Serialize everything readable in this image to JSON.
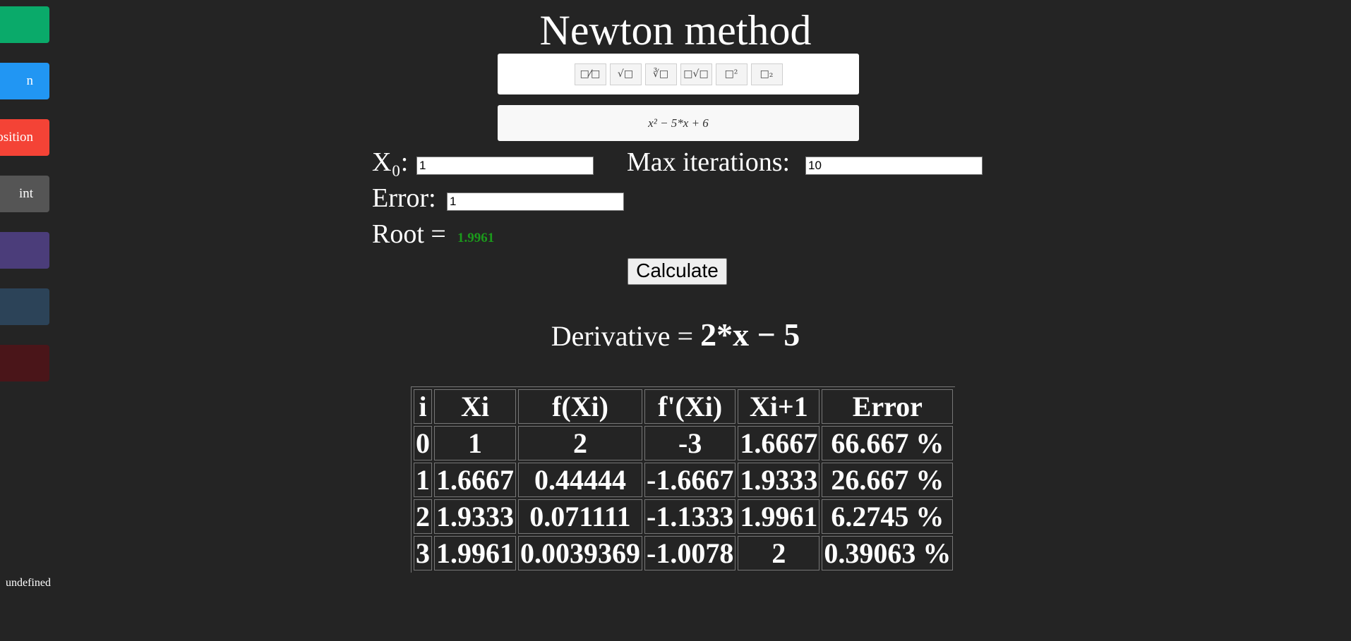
{
  "sidebar": {
    "items": [
      {
        "label": "",
        "color": "#0aaa6a"
      },
      {
        "label": "n",
        "color": "#2196f3"
      },
      {
        "label": "osition",
        "color": "#f44336"
      },
      {
        "label": "int",
        "color": "#555555"
      },
      {
        "label": "",
        "color": "#4b3d7a"
      },
      {
        "label": "",
        "color": "#2c4358"
      },
      {
        "label": "",
        "color": "#4a1519"
      }
    ],
    "footer": "undefined"
  },
  "page": {
    "title": "Newton method"
  },
  "toolbar": {
    "buttons": [
      {
        "icon": "fraction-icon",
        "glyph": "□⁄□"
      },
      {
        "icon": "sqrt-icon",
        "glyph": "√□"
      },
      {
        "icon": "cube-root-icon",
        "glyph": "∛□"
      },
      {
        "icon": "nth-root-icon",
        "glyph": "□√□"
      },
      {
        "icon": "superscript-icon",
        "glyph": "□²"
      },
      {
        "icon": "subscript-icon",
        "glyph": "□₂"
      }
    ]
  },
  "formula": {
    "value": "x² − 5*x + 6"
  },
  "inputs": {
    "x0_label": "X₀:",
    "x0_value": "1",
    "max_iter_label": "Max iterations:",
    "max_iter_value": "10",
    "error_label": "Error:",
    "error_value": "1",
    "root_label": "Root =",
    "root_value": "1.9961"
  },
  "calculate_label": "Calculate",
  "derivative": {
    "label": "Derivative =",
    "expr": "2*x − 5"
  },
  "table": {
    "headers": [
      "i",
      "Xi",
      "f(Xi)",
      "f'(Xi)",
      "Xi+1",
      "Error"
    ],
    "rows": [
      [
        "0",
        "1",
        "2",
        "-3",
        "1.6667",
        "66.667 %"
      ],
      [
        "1",
        "1.6667",
        "0.44444",
        "-1.6667",
        "1.9333",
        "26.667 %"
      ],
      [
        "2",
        "1.9333",
        "0.071111",
        "-1.1333",
        "1.9961",
        "6.2745 %"
      ],
      [
        "3",
        "1.9961",
        "0.0039369",
        "-1.0078",
        "2",
        "0.39063 %"
      ]
    ]
  }
}
